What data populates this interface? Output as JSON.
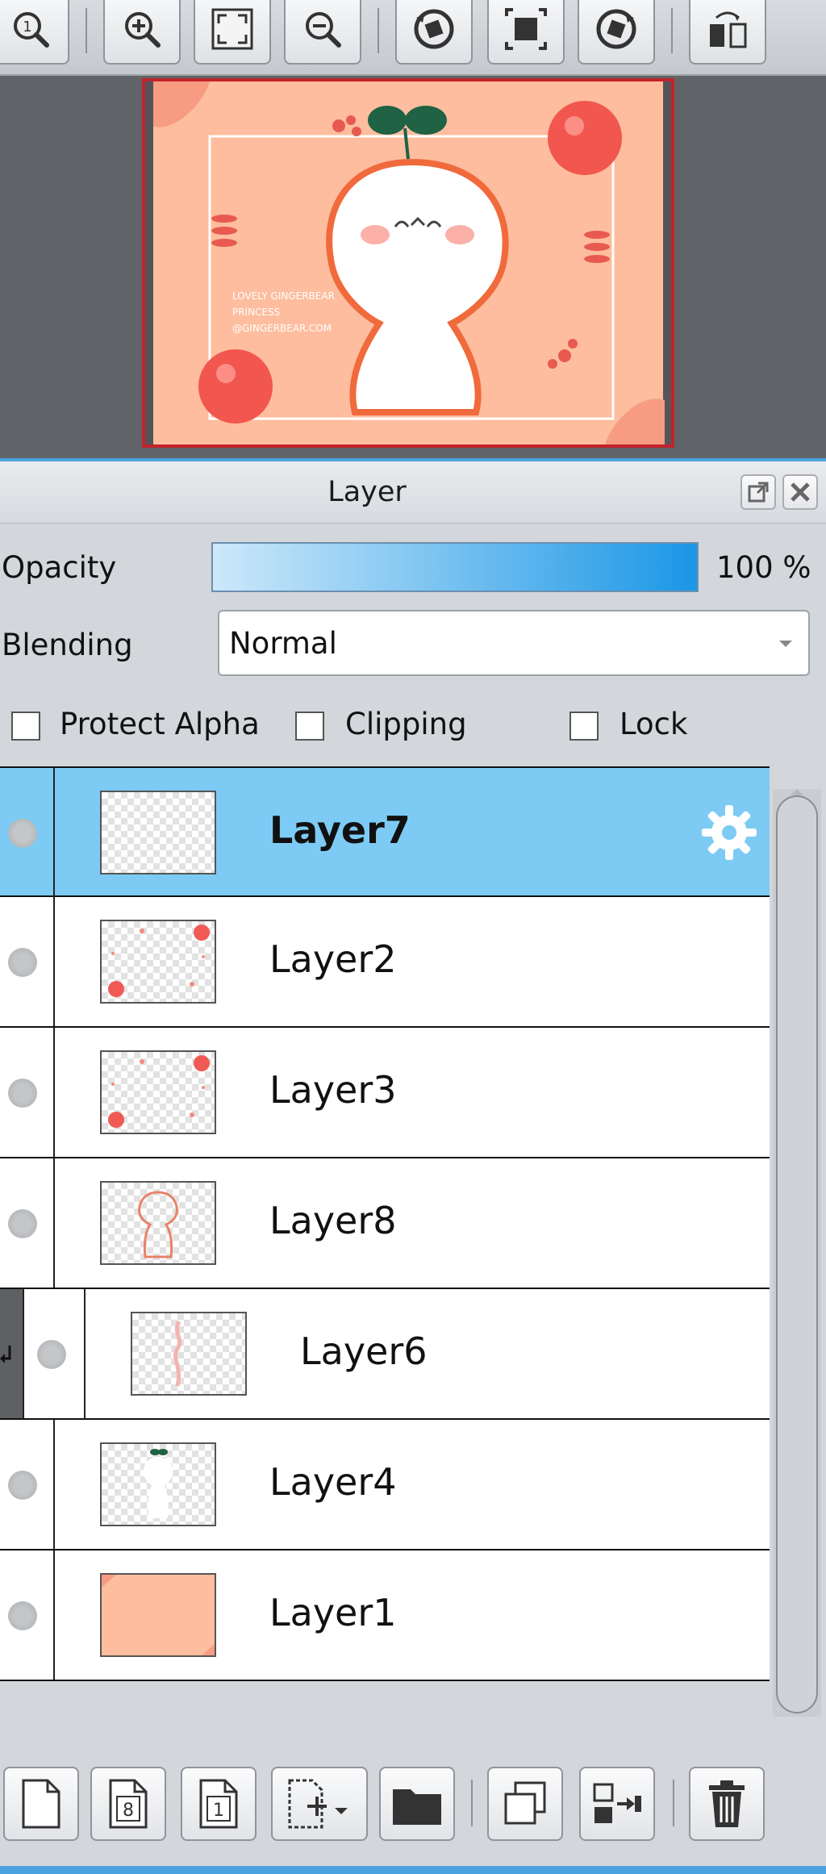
{
  "toolbar": {
    "buttons": [
      "zoom-reset",
      "zoom-in",
      "fit-window",
      "zoom-out",
      "rotate-left",
      "fit-canvas",
      "rotate-right",
      "flip-horizontal"
    ]
  },
  "navigator": {
    "artwork_text": [
      "LOVELY GINGERBEAR",
      "PRINCESS",
      "@GINGERBEAR.COM"
    ]
  },
  "layer_panel": {
    "title": "Layer",
    "opacity_label": "Opacity",
    "opacity_value": 1.0,
    "opacity_text": "100 %",
    "blending_label": "Blending",
    "blending_value": "Normal",
    "protect_alpha_label": "Protect Alpha",
    "clipping_label": "Clipping",
    "lock_label": "Lock",
    "layers": [
      {
        "name": "Layer7",
        "selected": true,
        "clipped": false
      },
      {
        "name": "Layer2",
        "selected": false,
        "clipped": false
      },
      {
        "name": "Layer3",
        "selected": false,
        "clipped": false
      },
      {
        "name": "Layer8",
        "selected": false,
        "clipped": false
      },
      {
        "name": "Layer6",
        "selected": false,
        "clipped": true
      },
      {
        "name": "Layer4",
        "selected": false,
        "clipped": false
      },
      {
        "name": "Layer1",
        "selected": false,
        "clipped": false
      }
    ]
  },
  "bottom_bar": {
    "new_layer_8bit_text": "8",
    "new_layer_1bit_text": "1"
  },
  "colors": {
    "accent": "#4aa3e0",
    "selected_row": "#7dcbf4",
    "canvas_bg": "#fdbd9e",
    "navigator_frame": "#c2232b"
  }
}
